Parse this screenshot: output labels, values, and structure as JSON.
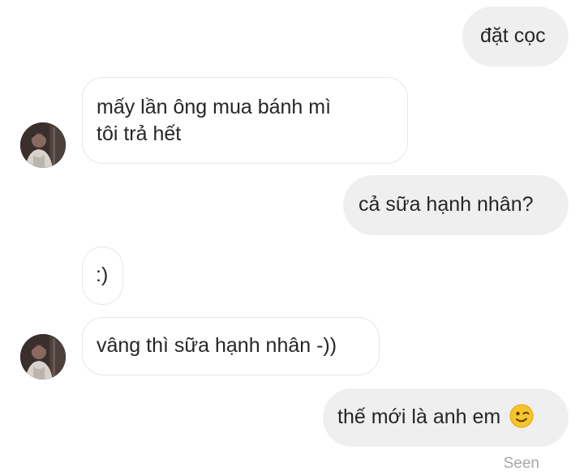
{
  "conversation": {
    "messages": [
      {
        "sender": "me",
        "text": "đặt cọc"
      },
      {
        "sender": "them",
        "lines": [
          "mấy lần ông mua bánh mì",
          "tôi trả hết"
        ]
      },
      {
        "sender": "me",
        "text": "cả sữa hạnh nhân?"
      },
      {
        "sender": "them",
        "text": ":)"
      },
      {
        "sender": "them",
        "text": "vâng thì sữa hạnh nhân -))"
      },
      {
        "sender": "me",
        "text": "thế mới là anh em",
        "emoji": "winking-face-emoji"
      }
    ],
    "status": "Seen"
  },
  "colors": {
    "outgoing_bubble": "#efefef",
    "incoming_border": "#e6e6e6",
    "text": "#262626",
    "seen_text": "#a8a8a8"
  }
}
